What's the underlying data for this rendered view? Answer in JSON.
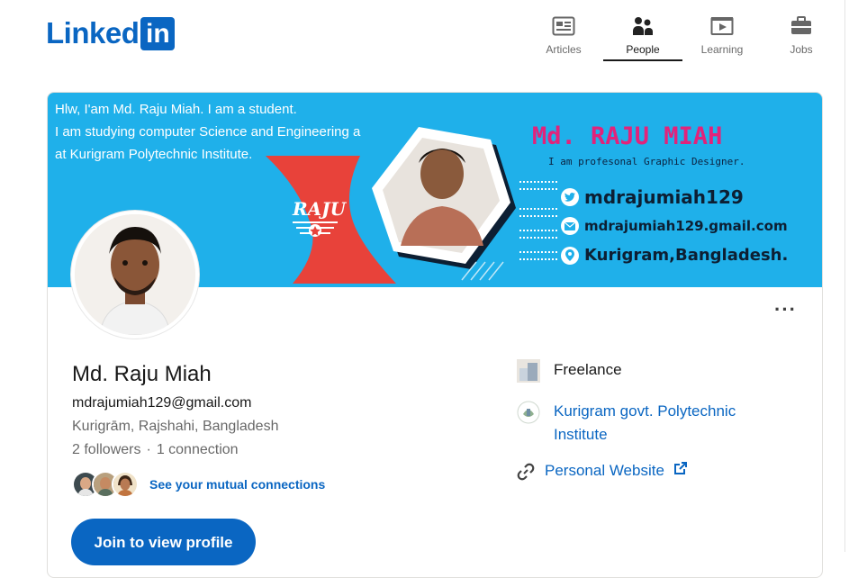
{
  "header": {
    "logo_text": "Linked",
    "logo_box": "in",
    "nav": [
      {
        "label": "Articles",
        "icon": "articles-icon"
      },
      {
        "label": "People",
        "icon": "people-icon"
      },
      {
        "label": "Learning",
        "icon": "learning-icon"
      },
      {
        "label": "Jobs",
        "icon": "jobs-icon"
      }
    ],
    "active_nav": "People"
  },
  "cover": {
    "intro_lines": [
      "Hlw, I'am Md. Raju Miah. I am a student.",
      "I am studying computer Science and Engineering a",
      "at Kurigram Polytechnic Institute."
    ],
    "badge_text": "RAJU",
    "name": "Md. RAJU MIAH",
    "tagline": "I am profesonal Graphic Designer.",
    "twitter": "mdrajumiah129",
    "mail": "mdrajumiah129.gmail.com",
    "place": "Kurigram,Bangladesh."
  },
  "profile": {
    "name": "Md. Raju Miah",
    "email": "mdrajumiah129@gmail.com",
    "location": "Kurigrām, Rajshahi, Bangladesh",
    "followers": "2 followers",
    "separator": "·",
    "connections": "1 connection",
    "mutual_link": "See your mutual connections",
    "join_button": "Join to view profile",
    "more_button": "···"
  },
  "side": {
    "company": "Freelance",
    "school_line1": "Kurigram govt. Polytechnic",
    "school_line2": "Institute",
    "website": "Personal Website"
  },
  "colors": {
    "brand": "#0a66c2",
    "cover_bg": "#1fb0ea",
    "cover_name": "#e2237b",
    "red_shape": "#e8423a"
  }
}
